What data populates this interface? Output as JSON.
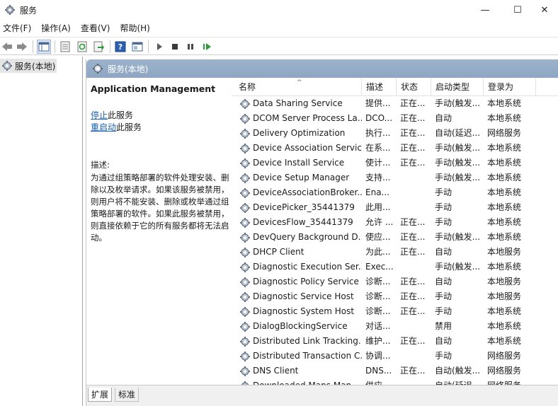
{
  "window": {
    "title": "服务",
    "controls": {
      "minimize": "—",
      "maximize": "☐",
      "close": "✕"
    }
  },
  "menu": [
    "文件(F)",
    "操作(A)",
    "查看(V)",
    "帮助(H)"
  ],
  "toolbar_icons": [
    "back-icon",
    "forward-icon",
    "console-tree-icon",
    "properties-icon",
    "refresh-icon",
    "export-icon",
    "help-icon",
    "view-icon",
    "play-icon",
    "stop-icon",
    "pause-icon",
    "restart-icon"
  ],
  "tree": {
    "root_label": "服务(本地)"
  },
  "pane": {
    "header_label": "服务(本地)"
  },
  "detail": {
    "service_title": "Application Management",
    "stop_link": "停止",
    "stop_suffix": "此服务",
    "restart_link": "重启动",
    "restart_suffix": "此服务",
    "desc_label": "描述:",
    "desc_text": "为通过组策略部署的软件处理安装、删除以及枚举请求。如果该服务被禁用，则用户将不能安装、删除或枚举通过组策略部署的软件。如果此服务被禁用，则直接依赖于它的所有服务都将无法启动。"
  },
  "columns": {
    "name": "名称",
    "desc": "描述",
    "state": "状态",
    "startup": "启动类型",
    "logon": "登录为"
  },
  "services": [
    {
      "name": "Data Sharing Service",
      "desc": "提供...",
      "state": "正在...",
      "startup": "手动(触发...",
      "logon": "本地系统"
    },
    {
      "name": "DCOM Server Process La...",
      "desc": "DCO...",
      "state": "正在...",
      "startup": "自动",
      "logon": "本地系统"
    },
    {
      "name": "Delivery Optimization",
      "desc": "执行...",
      "state": "正在...",
      "startup": "自动(延迟...",
      "logon": "网络服务"
    },
    {
      "name": "Device Association Service",
      "desc": "在系...",
      "state": "正在...",
      "startup": "手动(触发...",
      "logon": "本地系统"
    },
    {
      "name": "Device Install Service",
      "desc": "使计...",
      "state": "正在...",
      "startup": "手动(触发...",
      "logon": "本地系统"
    },
    {
      "name": "Device Setup Manager",
      "desc": "支持...",
      "state": "",
      "startup": "手动(触发...",
      "logon": "本地系统"
    },
    {
      "name": "DeviceAssociationBroker...",
      "desc": "Ena...",
      "state": "",
      "startup": "手动",
      "logon": "本地系统"
    },
    {
      "name": "DevicePicker_35441379",
      "desc": "此用...",
      "state": "",
      "startup": "手动",
      "logon": "本地系统"
    },
    {
      "name": "DevicesFlow_35441379",
      "desc": "允许 ...",
      "state": "正在...",
      "startup": "手动",
      "logon": "本地系统"
    },
    {
      "name": "DevQuery Background D...",
      "desc": "使应...",
      "state": "正在...",
      "startup": "手动(触发...",
      "logon": "本地系统"
    },
    {
      "name": "DHCP Client",
      "desc": "为此...",
      "state": "正在...",
      "startup": "自动",
      "logon": "本地服务"
    },
    {
      "name": "Diagnostic Execution Ser...",
      "desc": "Exec...",
      "state": "",
      "startup": "手动(触发...",
      "logon": "本地系统"
    },
    {
      "name": "Diagnostic Policy Service",
      "desc": "诊断...",
      "state": "正在...",
      "startup": "自动",
      "logon": "本地服务"
    },
    {
      "name": "Diagnostic Service Host",
      "desc": "诊断...",
      "state": "正在...",
      "startup": "手动",
      "logon": "本地服务"
    },
    {
      "name": "Diagnostic System Host",
      "desc": "诊断...",
      "state": "正在...",
      "startup": "手动",
      "logon": "本地系统"
    },
    {
      "name": "DialogBlockingService",
      "desc": "对话...",
      "state": "",
      "startup": "禁用",
      "logon": "本地系统"
    },
    {
      "name": "Distributed Link Tracking...",
      "desc": "维护...",
      "state": "正在...",
      "startup": "自动",
      "logon": "本地系统"
    },
    {
      "name": "Distributed Transaction C...",
      "desc": "协调...",
      "state": "",
      "startup": "手动",
      "logon": "网络服务"
    },
    {
      "name": "DNS Client",
      "desc": "DNS...",
      "state": "正在...",
      "startup": "自动(触发...",
      "logon": "网络服务"
    },
    {
      "name": "Downloaded Maps Man...",
      "desc": "供应...",
      "state": "",
      "startup": "自动(延迟...",
      "logon": "网络服务"
    }
  ],
  "tabs": [
    "扩展",
    "标准"
  ]
}
